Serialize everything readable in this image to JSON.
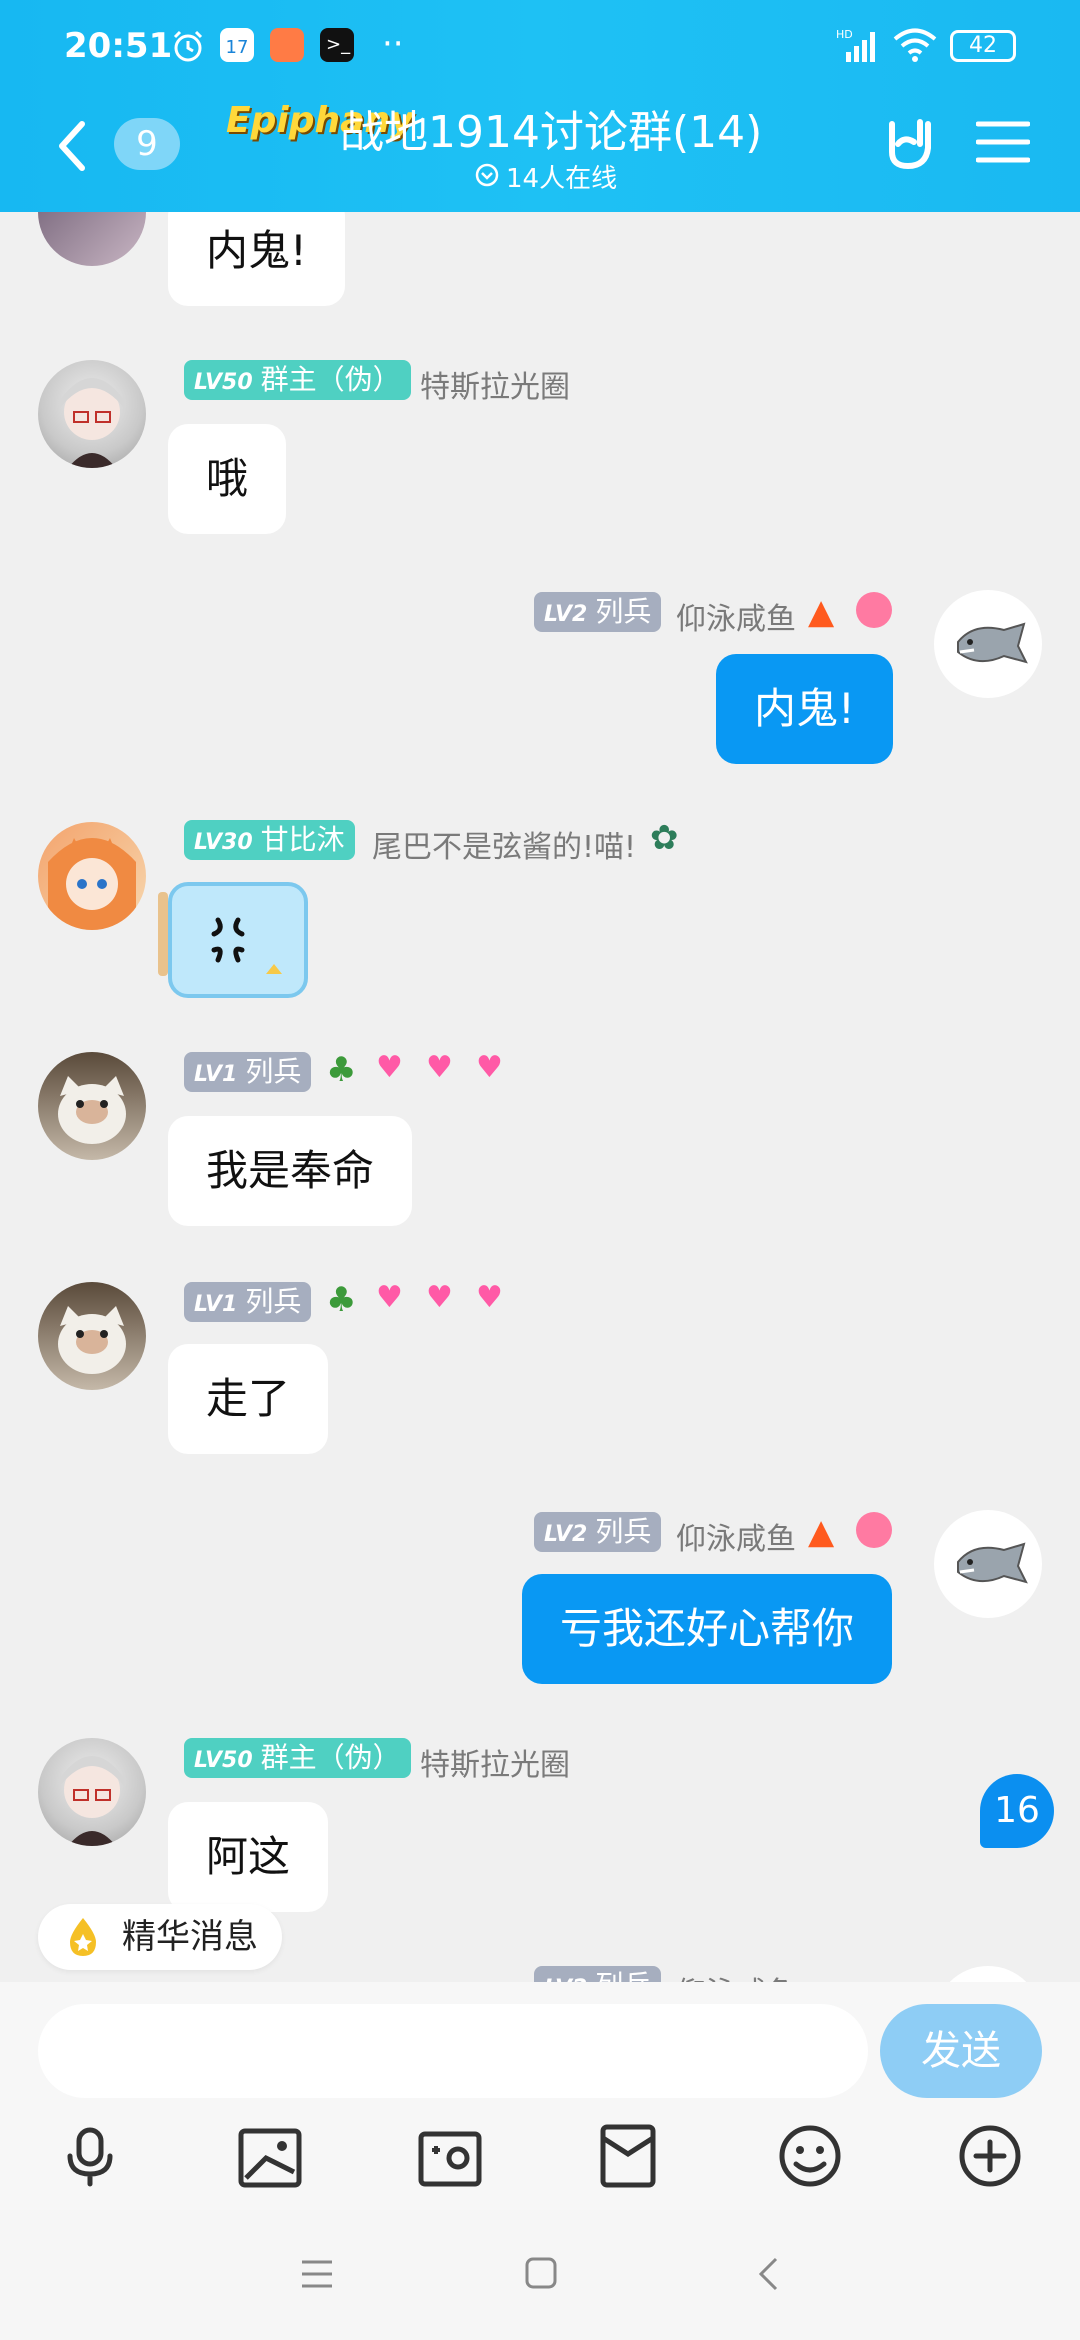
{
  "status_bar": {
    "time": "20:51",
    "network": "HD",
    "battery": "42"
  },
  "header": {
    "back_count": "9",
    "logo_text": "Epiphany",
    "title": "战地1914讨论群(14)",
    "online": "14人在线"
  },
  "messages": [
    {
      "side": "left",
      "text": "内鬼!"
    },
    {
      "side": "left",
      "level": "LV50",
      "title": "群主（伪）",
      "nickname": "特斯拉光圈",
      "text": "哦"
    },
    {
      "side": "right",
      "level": "LV2",
      "title": "列兵",
      "nickname": "仰泳咸鱼",
      "text": "内鬼!"
    },
    {
      "side": "left",
      "level": "LV30",
      "title": "甘比沐",
      "nickname": "尾巴不是弦酱的!喵!",
      "sticker": "anger-symbol"
    },
    {
      "side": "left",
      "level": "LV1",
      "title": "列兵",
      "nickname": "",
      "text": "我是奉命"
    },
    {
      "side": "left",
      "level": "LV1",
      "title": "列兵",
      "nickname": "",
      "text": "走了"
    },
    {
      "side": "right",
      "level": "LV2",
      "title": "列兵",
      "nickname": "仰泳咸鱼",
      "text": "亏我还好心帮你"
    },
    {
      "side": "left",
      "level": "LV50",
      "title": "群主（伪）",
      "nickname": "特斯拉光圈",
      "text": "阿这"
    }
  ],
  "new_message_count": "16",
  "essence_label": "精华消息",
  "input": {
    "placeholder": "",
    "send_label": "发送"
  },
  "toolbar": {
    "icons": [
      "microphone-icon",
      "image-icon",
      "camera-icon",
      "red-packet-icon",
      "emoji-icon",
      "plus-icon"
    ]
  },
  "colors": {
    "header": "#1ab9f2",
    "my_bubble": "#0998f3",
    "tag_green": "#4fd0c2",
    "tag_gray": "#a6aebf",
    "badge": "#0b8ff0"
  }
}
